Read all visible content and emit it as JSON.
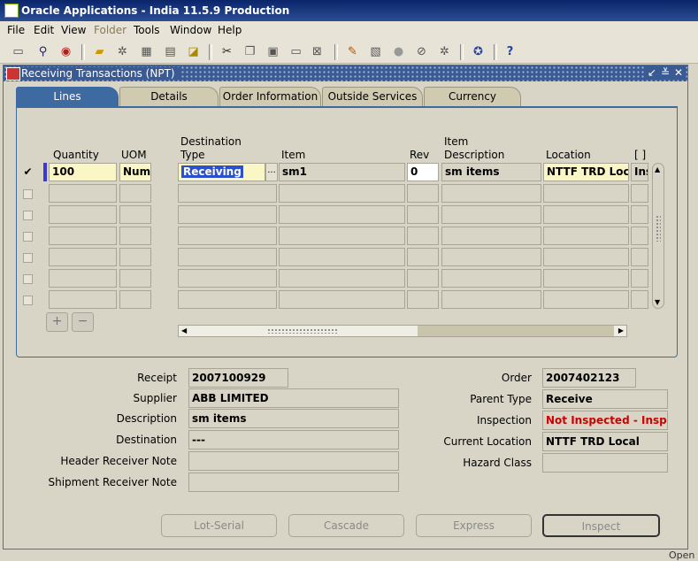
{
  "app": {
    "title": "Oracle Applications - India 11.5.9 Production",
    "menu": [
      "File",
      "Edit",
      "View",
      "Folder",
      "Tools",
      "Window",
      "Help"
    ],
    "disabled_menu": "Folder"
  },
  "window": {
    "title": "Receiving Transactions (NPT)",
    "controls": [
      "↙",
      "≚",
      "✕"
    ]
  },
  "tabs": [
    "Lines",
    "Details",
    "Order Information",
    "Outside Services",
    "Currency"
  ],
  "active_tab": "Lines",
  "grid": {
    "headers": {
      "quantity": "Quantity",
      "uom": "UOM",
      "dest_type_1": "Destination",
      "dest_type_2": "Type",
      "item": "Item",
      "rev": "Rev",
      "item_desc_1": "Item",
      "item_desc_2": "Description",
      "location": "Location",
      "extra": "[ ]"
    },
    "row1": {
      "checked": "✔",
      "quantity": "100",
      "uom": "Numb",
      "dest_type": "Receiving",
      "lov": "...",
      "item": "sm1",
      "rev": "0",
      "item_desc": "sm items",
      "location": "NTTF TRD Loc",
      "extra": "Ins"
    }
  },
  "form": {
    "receipt_label": "Receipt",
    "receipt": "2007100929",
    "supplier_label": "Supplier",
    "supplier": "ABB LIMITED",
    "description_label": "Description",
    "description": "sm items",
    "destination_label": "Destination",
    "destination": "---",
    "header_note_label": "Header Receiver Note",
    "header_note": "",
    "shipment_note_label": "Shipment Receiver Note",
    "shipment_note": "",
    "order_label": "Order",
    "order": "2007402123",
    "parent_type_label": "Parent Type",
    "parent_type": "Receive",
    "inspection_label": "Inspection",
    "inspection": "Not Inspected - Inspec",
    "current_location_label": "Current Location",
    "current_location": "NTTF TRD Local",
    "hazard_class_label": "Hazard Class",
    "hazard_class": ""
  },
  "buttons": {
    "lot_serial": "Lot-Serial",
    "cascade": "Cascade",
    "express": "Express",
    "inspect": "Inspect"
  },
  "icons": {
    "add": "+",
    "remove": "−"
  },
  "footer_fragment": "Open",
  "colors": {
    "title_bar": "#0a246a",
    "active_tab": "#3d6aa0",
    "required_field": "#fbf6c6",
    "error_text": "#d00000"
  }
}
